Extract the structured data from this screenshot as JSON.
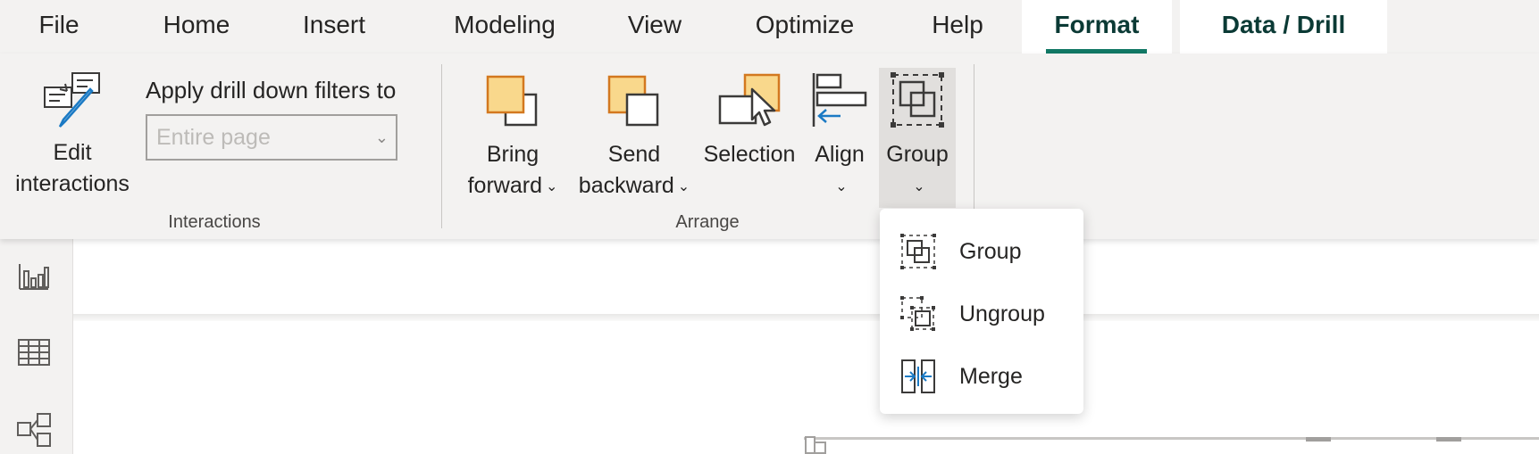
{
  "tabs": [
    {
      "label": "File",
      "active": false,
      "contextual": false
    },
    {
      "label": "Home",
      "active": false,
      "contextual": false
    },
    {
      "label": "Insert",
      "active": false,
      "contextual": false
    },
    {
      "label": "Modeling",
      "active": false,
      "contextual": false
    },
    {
      "label": "View",
      "active": false,
      "contextual": false
    },
    {
      "label": "Optimize",
      "active": false,
      "contextual": false
    },
    {
      "label": "Help",
      "active": false,
      "contextual": false
    },
    {
      "label": "Format",
      "active": true,
      "contextual": true
    },
    {
      "label": "Data / Drill",
      "active": false,
      "contextual": true
    }
  ],
  "ribbon": {
    "interactions": {
      "edit_label_1": "Edit",
      "edit_label_2": "interactions",
      "apply_label": "Apply drill down filters to",
      "apply_select_value": "Entire page",
      "group_label": "Interactions"
    },
    "arrange": {
      "bring_forward_1": "Bring",
      "bring_forward_2": "forward",
      "send_backward_1": "Send",
      "send_backward_2": "backward",
      "selection": "Selection",
      "align": "Align",
      "group": "Group",
      "group_label": "Arrange"
    }
  },
  "group_menu": {
    "items": [
      {
        "label": "Group",
        "icon": "group-icon"
      },
      {
        "label": "Ungroup",
        "icon": "ungroup-icon"
      },
      {
        "label": "Merge",
        "icon": "merge-icon"
      }
    ]
  },
  "rail": {
    "icons": [
      "report-view-icon",
      "table-view-icon",
      "model-view-icon"
    ]
  },
  "colors": {
    "accent": "#117865",
    "contextual_tab_text": "#0b3a35",
    "shape_fill": "#f9d88c",
    "shape_stroke": "#d3781f",
    "icon_blue": "#1b7ac4"
  }
}
